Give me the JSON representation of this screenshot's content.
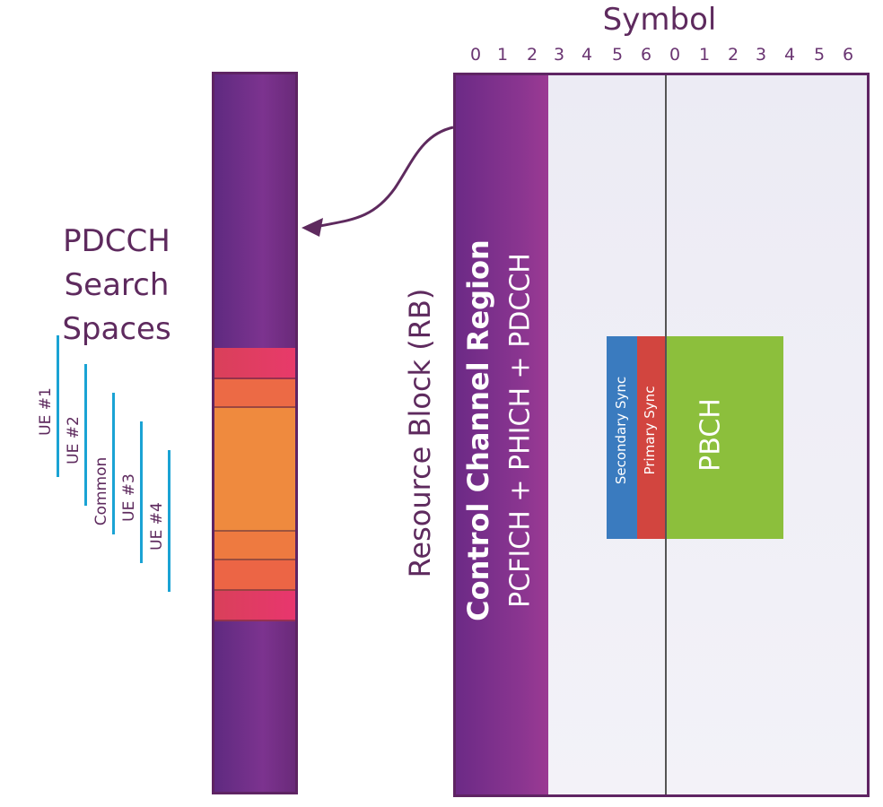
{
  "title": "Symbol",
  "symbols": [
    "0",
    "1",
    "2",
    "3",
    "4",
    "5",
    "6",
    "0",
    "1",
    "2",
    "3",
    "4",
    "5",
    "6"
  ],
  "rb_label": "Resource Block (RB)",
  "control_region": {
    "title": "Control Channel Region",
    "channels": "PCFICH + PHICH + PDCCH"
  },
  "secondary_sync": "Secondary Sync",
  "primary_sync": "Primary Sync",
  "pbch": "PBCH",
  "search_spaces": {
    "title_lines": [
      "PDCCH",
      "Search",
      "Spaces"
    ],
    "items": [
      "UE #1",
      "UE #2",
      "Common",
      "UE #3",
      "UE #4"
    ]
  },
  "colors": {
    "control": "#7a2f8c",
    "secondary_sync": "#3a7bbf",
    "primary_sync": "#d2453f",
    "pbch": "#8cbf3c",
    "search_line": "#1aa3d4",
    "text": "#5e2a5e"
  }
}
